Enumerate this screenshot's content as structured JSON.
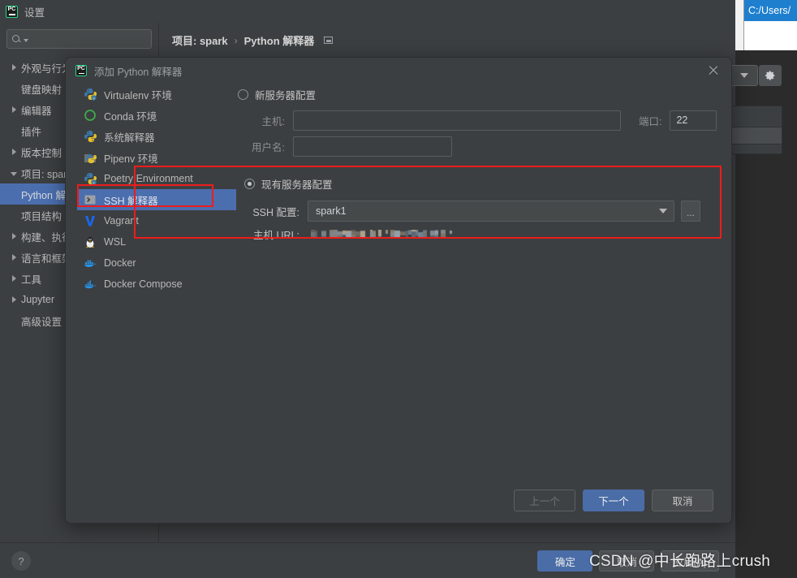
{
  "background_window": {
    "title": "C:/Users/"
  },
  "settings_window": {
    "title": "设置",
    "logo_text": "PC",
    "search": {
      "value": "",
      "placeholder": ""
    },
    "breadcrumb": {
      "project": "项目: spark",
      "separator": "›",
      "page": "Python 解释器"
    },
    "sidebar": [
      {
        "label": "外观与行为",
        "level": 0,
        "expandable": true,
        "expanded": false
      },
      {
        "label": "键盘映射",
        "level": 1,
        "expandable": false
      },
      {
        "label": "编辑器",
        "level": 0,
        "expandable": true,
        "expanded": false
      },
      {
        "label": "插件",
        "level": 1,
        "expandable": false
      },
      {
        "label": "版本控制",
        "level": 0,
        "expandable": true,
        "expanded": false
      },
      {
        "label": "项目: spark",
        "level": 0,
        "expandable": true,
        "expanded": true
      },
      {
        "label": "Python 解释器",
        "level": 1,
        "expandable": false,
        "selected": true
      },
      {
        "label": "项目结构",
        "level": 1,
        "expandable": false
      },
      {
        "label": "构建、执行、部署",
        "level": 0,
        "expandable": true,
        "expanded": false
      },
      {
        "label": "语言和框架",
        "level": 0,
        "expandable": true,
        "expanded": false
      },
      {
        "label": "工具",
        "level": 0,
        "expandable": true,
        "expanded": false
      },
      {
        "label": "Jupyter",
        "level": 0,
        "expandable": true,
        "expanded": false
      },
      {
        "label": "高级设置",
        "level": 1,
        "expandable": false
      }
    ],
    "footer": {
      "help_label": "?",
      "buttons": [
        {
          "label": "确定",
          "style": "primary"
        },
        {
          "label": "取消",
          "style": "normal"
        },
        {
          "label": "应用(A)",
          "style": "normal"
        }
      ]
    }
  },
  "dialog": {
    "title": "添加 Python 解释器",
    "logo_text": "PC",
    "close_icon": "close-icon",
    "interpreter_types": [
      {
        "label": "Virtualenv 环境",
        "icon": "python-venv-icon",
        "selected": false
      },
      {
        "label": "Conda 环境",
        "icon": "conda-icon",
        "selected": false
      },
      {
        "label": "系统解释器",
        "icon": "python-icon",
        "selected": false
      },
      {
        "label": "Pipenv 环境",
        "icon": "pipenv-icon",
        "selected": false
      },
      {
        "label": "Poetry Environment",
        "icon": "poetry-icon",
        "selected": false
      },
      {
        "label": "SSH 解释器",
        "icon": "ssh-terminal-icon",
        "selected": true
      },
      {
        "label": "Vagrant",
        "icon": "vagrant-icon",
        "selected": false
      },
      {
        "label": "WSL",
        "icon": "linux-penguin-icon",
        "selected": false
      },
      {
        "label": "Docker",
        "icon": "docker-icon",
        "selected": false
      },
      {
        "label": "Docker Compose",
        "icon": "docker-compose-icon",
        "selected": false
      }
    ],
    "new_server": {
      "radio_label": "新服务器配置",
      "selected": false,
      "host_label": "主机:",
      "host_value": "",
      "port_label": "端口:",
      "port_value": "22",
      "username_label": "用户名:",
      "username_value": ""
    },
    "existing_server": {
      "radio_label": "现有服务器配置",
      "selected": true,
      "ssh_config_label": "SSH 配置:",
      "ssh_config_value": "spark1",
      "browse_button_label": "...",
      "host_url_label": "主机 URL:",
      "host_url_value": ""
    },
    "buttons": [
      {
        "label": "上一个",
        "style": "disabled"
      },
      {
        "label": "下一个",
        "style": "primary"
      },
      {
        "label": "取消",
        "style": "normal"
      }
    ]
  },
  "annotations": {
    "highlight_color": "#ee1c1c"
  },
  "watermark": {
    "brand": "CSDN",
    "author": "@中长跑路上crush"
  }
}
